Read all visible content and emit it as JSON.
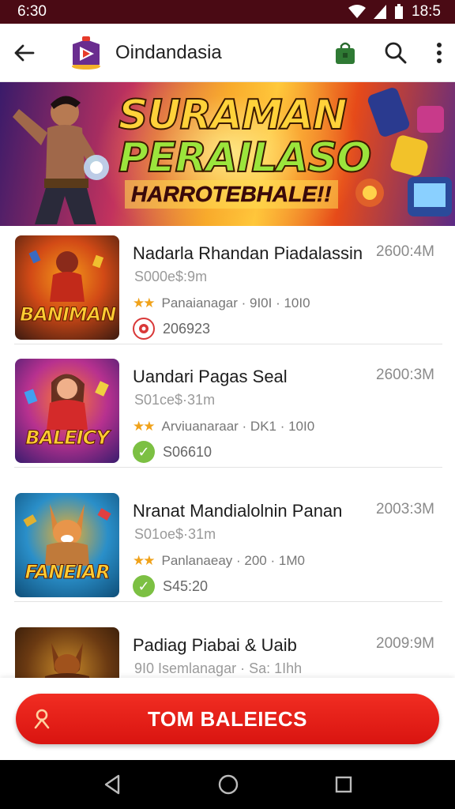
{
  "status_bar": {
    "time": "6:30",
    "right_time": "18:5"
  },
  "app_bar": {
    "title": "Oindandasia"
  },
  "banner": {
    "line1": "SURAMAN",
    "line2": "PERAILASO",
    "line3": "HARROTEBHALE!!"
  },
  "games": [
    {
      "title": "Nadarla Rhandan Piadalassin",
      "size": "2600:4M",
      "subtitle": "S000e$:9m",
      "rating_text": "Panaianagar · 9I0I · 10I0",
      "status_text": "206923",
      "status_icon": "record-icon",
      "thumb_caption": "BANIMAN",
      "thumb_colors": [
        "#3b1a10",
        "#d24a16",
        "#f59a1a"
      ]
    },
    {
      "title": "Uandari Pagas Seal",
      "size": "2600:3M",
      "subtitle": "S01ce$·31m",
      "rating_text": "Arviuanaraar · DK1 · 10I0",
      "status_text": "S06610",
      "status_icon": "check-icon",
      "thumb_caption": "BALEICY",
      "thumb_colors": [
        "#3a1c6e",
        "#b7318f",
        "#ff7b2e"
      ]
    },
    {
      "title": "Nranat Mandialolnin Panan",
      "size": "2003:3M",
      "subtitle": "S01oe$·31m",
      "rating_text": "Panlanaeay · 200 · 1M0",
      "status_text": "S45:20",
      "status_icon": "check-icon",
      "thumb_caption": "FANEIAR",
      "thumb_colors": [
        "#0f4e78",
        "#2a8fc9",
        "#f2b02a"
      ]
    },
    {
      "title": "Padiag Piabai & Uaib",
      "size": "2009:9M",
      "subtitle": "9I0 Isemlanagar · Sa: 1Ihh",
      "rating_text": "",
      "status_text": "",
      "status_icon": "",
      "thumb_caption": "",
      "thumb_colors": [
        "#241207",
        "#6b3a12",
        "#c88a2a"
      ]
    }
  ],
  "cta": {
    "label": "TOM BALEIECS",
    "icon": "person-icon"
  },
  "colors": {
    "accent": "#e41b14",
    "status_bar": "#4a0a14",
    "star": "#f0a21a",
    "check": "#7cc043"
  }
}
